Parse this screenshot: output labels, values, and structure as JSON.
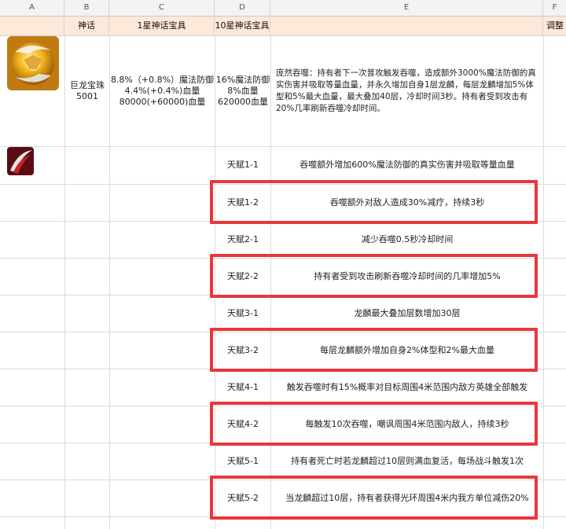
{
  "columns": [
    "A",
    "B",
    "C",
    "D",
    "E",
    "F"
  ],
  "headers": {
    "b": "神话",
    "c": "1星神话宝具",
    "d": "10星神话宝具",
    "f": "调整"
  },
  "item": {
    "name": "巨龙宝珠",
    "id": "5001",
    "one_star": [
      "8.8%（+0.8%）魔法防御",
      "4.4%(+0.4%)血量",
      "80000(+60000)血量"
    ],
    "ten_star": [
      "16%魔法防御",
      "8%血量",
      "620000血量"
    ],
    "description": "庞然吞噬：持有者下一次普攻触发吞噬，造成额外3000%魔法防御的真实伤害并吸取等量血量，并永久增加自身1层龙麟，每层龙麟增加5%体型和5%最大血量，最大叠加40层，冷却时间3秒。持有者受到攻击有20%几率刷新吞噬冷却时间。"
  },
  "talents": [
    {
      "id": "天赋1-1",
      "text": "吞噬额外增加600%魔法防御的真实伤害并吸取等量血量",
      "highlighted": false
    },
    {
      "id": "天赋1-2",
      "text": "吞噬额外对敌人造成30%减疗，持续3秒",
      "highlighted": true
    },
    {
      "id": "天赋2-1",
      "text": "减少吞噬0.5秒冷却时间",
      "highlighted": false
    },
    {
      "id": "天赋2-2",
      "text": "持有者受到攻击刷新吞噬冷却时间的几率增加5%",
      "highlighted": true
    },
    {
      "id": "天赋3-1",
      "text": "龙麟最大叠加层数增加30层",
      "highlighted": false
    },
    {
      "id": "天赋3-2",
      "text": "每层龙麟额外增加自身2%体型和2%最大血量",
      "highlighted": true
    },
    {
      "id": "天赋4-1",
      "text": "触发吞噬时有15%概率对目标周围4米范围内敌方英雄全部触发",
      "highlighted": false
    },
    {
      "id": "天赋4-2",
      "text": "每触发10次吞噬，嘲讽周围4米范围内敌人，持续3秒",
      "highlighted": true
    },
    {
      "id": "天赋5-1",
      "text": "持有者死亡时若龙麟超过10层则满血复活，每场战斗触发1次",
      "highlighted": false
    },
    {
      "id": "天赋5-2",
      "text": "当龙麟超过10层，持有者获得光环周围4米内我方单位减伤20%",
      "highlighted": true
    }
  ],
  "colors": {
    "header_bg": "#fde9d9",
    "highlight_border": "#e8383d",
    "grid": "#dcdcdc"
  },
  "icons": [
    "dragon-orb-icon",
    "talent-slash-icon"
  ]
}
